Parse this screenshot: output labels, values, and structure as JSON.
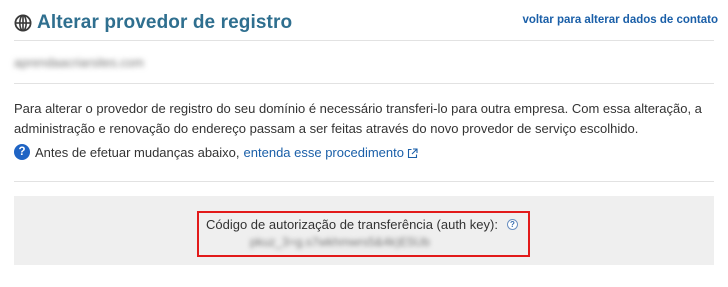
{
  "header": {
    "title": "Alterar provedor de registro",
    "back_link": "voltar para alterar dados de contato",
    "icon": "globe-icon"
  },
  "domain": {
    "name": "aprendaacriarsites.com"
  },
  "description": "Para alterar o provedor de registro do seu domínio é necessário transferi-lo para outra empresa. Com essa alteração, a administração e renovação do endereço passam a ser feitas através do novo provedor de serviço escolhido.",
  "info": {
    "icon": "help-icon",
    "text": "Antes de efetuar mudanças abaixo,",
    "link": "entenda esse procedimento",
    "link_icon": "external-link-icon"
  },
  "auth": {
    "label": "Código de autorização de transferência (auth key):",
    "help_glyph": "?",
    "key": "pkuz_3=g.s7wkhmwrs5&4k)E5Ub",
    "highlight_color": "#e21a1a"
  },
  "colors": {
    "title": "#2f6f8f",
    "link": "#1a5fa8",
    "panel": "#efefef"
  }
}
